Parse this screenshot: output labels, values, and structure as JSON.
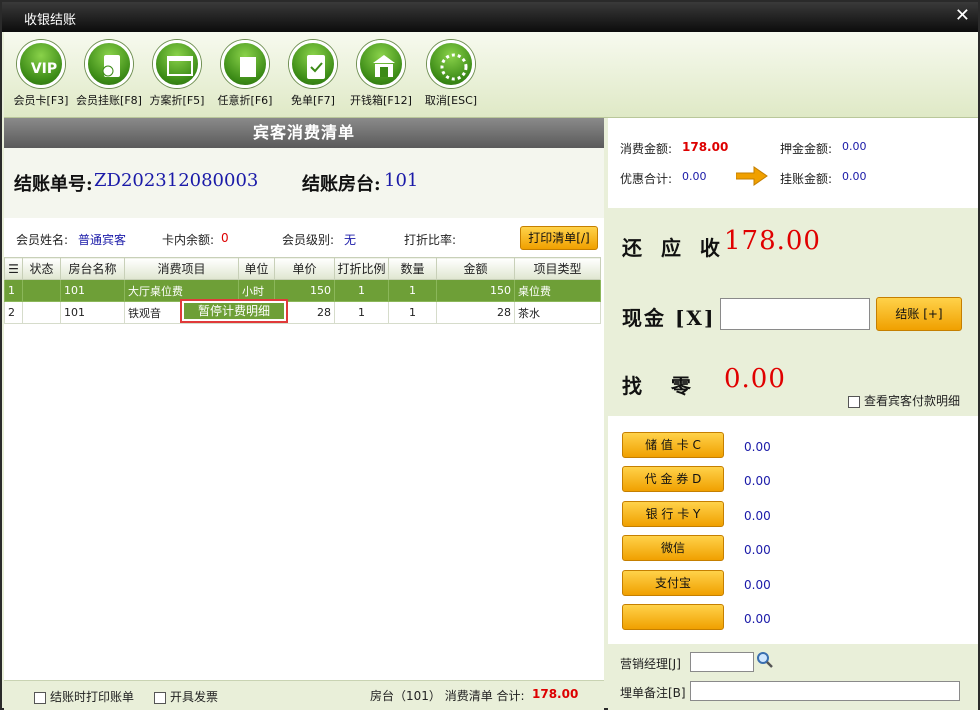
{
  "window": {
    "title": "收银结账",
    "close": "✕"
  },
  "toolbar": [
    {
      "label": "会员卡[F3]",
      "icon": "vip-icon"
    },
    {
      "label": "会员挂账[F8]",
      "icon": "member-credit-icon"
    },
    {
      "label": "方案折[F5]",
      "icon": "scheme-discount-icon"
    },
    {
      "label": "任意折[F6]",
      "icon": "custom-discount-icon"
    },
    {
      "label": "免单[F7]",
      "icon": "free-order-icon"
    },
    {
      "label": "开钱箱[F12]",
      "icon": "cash-drawer-icon"
    },
    {
      "label": "取消[ESC]",
      "icon": "cancel-icon"
    }
  ],
  "bill": {
    "heading": "宾客消费清单",
    "no_label": "结账单号:",
    "no_value": "ZD202312080003",
    "room_label": "结账房台:",
    "room_value": "101",
    "member_name_label": "会员姓名:",
    "member_name_value": "普通宾客",
    "card_balance_label": "卡内余额:",
    "card_balance_value": "0",
    "member_level_label": "会员级别:",
    "member_level_value": "无",
    "discount_rate_label": "打折比率:",
    "print_button": "打印清单[/]"
  },
  "table": {
    "headers": [
      "",
      "状态",
      "房台名称",
      "消费项目",
      "单位",
      "单价",
      "打折比例",
      "数量",
      "金额",
      "项目类型"
    ],
    "rows": [
      [
        "1",
        "",
        "101",
        "大厅桌位费",
        "小时",
        "150",
        "1",
        "1",
        "150",
        "桌位费"
      ],
      [
        "2",
        "",
        "101",
        "铁观音",
        "",
        "28",
        "1",
        "1",
        "28",
        "茶水"
      ]
    ]
  },
  "context_menu": {
    "item": "暂停计费明细"
  },
  "footer": {
    "print_on_checkout": "结账时打印账单",
    "issue_invoice": "开具发票",
    "summary": "房台（101） 消费清单 合计:",
    "total": "178.00"
  },
  "summary": {
    "consume_label": "消费金额:",
    "consume_value": "178.00",
    "deposit_label": "押金金额:",
    "deposit_value": "0.00",
    "discount_label": "优惠合计:",
    "discount_value": "0.00",
    "credit_label": "挂账金额:",
    "credit_value": "0.00"
  },
  "due": {
    "receivable_label": "还 应 收",
    "receivable_value": "178.00",
    "cash_label": "现金 [X]",
    "cash_value": "",
    "checkout_button": "结账 [+]",
    "change_label": "找   零",
    "change_value": "0.00",
    "view_guest_payment": "查看宾客付款明细"
  },
  "payments": [
    {
      "label": "储 值 卡 C",
      "value": "0.00"
    },
    {
      "label": "代 金 券 D",
      "value": "0.00"
    },
    {
      "label": "银 行 卡 Y",
      "value": "0.00"
    },
    {
      "label": "微信",
      "value": "0.00"
    },
    {
      "label": "支付宝",
      "value": "0.00"
    },
    {
      "label": "",
      "value": "0.00"
    }
  ],
  "bottom": {
    "manager_label": "营销经理[J]",
    "manager_value": "",
    "remark_label": "埋单备注[B]",
    "remark_value": ""
  },
  "colors": {
    "accent_green": "#6e9f37",
    "due_red": "#e00000",
    "button_orange": "#f0a000",
    "value_blue": "#1a1aa8"
  }
}
